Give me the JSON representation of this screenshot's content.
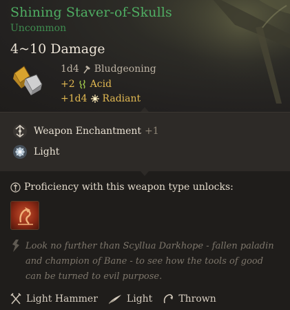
{
  "item": {
    "name": "Shining Staver-of-Skulls",
    "rarity": "Uncommon",
    "damage_total": "4~10 Damage",
    "damage_lines": [
      {
        "amount": "1d4",
        "type": "Bludgeoning",
        "icon": "hammer-icon"
      },
      {
        "amount": "+2",
        "type": "Acid",
        "icon": "acid-icon"
      },
      {
        "amount": "+1d4",
        "type": "Radiant",
        "icon": "radiant-icon"
      }
    ]
  },
  "properties": {
    "enchantment_label": "Weapon Enchantment",
    "enchantment_bonus": "+1",
    "light_label": "Light"
  },
  "proficiency": {
    "text": "Proficiency with this weapon type unlocks:"
  },
  "description": "Look no further than Scyllua Darkhope - fallen paladin and champion of Bane - to see how the tools of good can be turned to evil purpose.",
  "footer": {
    "weapon_type": "Light Hammer",
    "weight_tag": "Light",
    "thrown_tag": "Thrown"
  },
  "colors": {
    "name": "#4fae63",
    "rarity": "#3f8d50",
    "bonus_damage": "#e2b952",
    "description": "#7d766b"
  }
}
